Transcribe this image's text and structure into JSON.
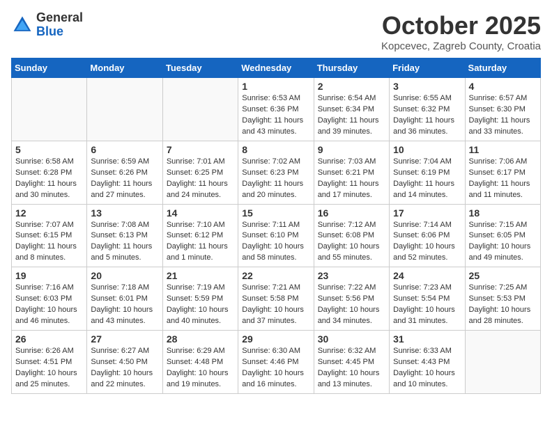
{
  "header": {
    "logo_general": "General",
    "logo_blue": "Blue",
    "month_title": "October 2025",
    "location": "Kopcevec, Zagreb County, Croatia"
  },
  "days_of_week": [
    "Sunday",
    "Monday",
    "Tuesday",
    "Wednesday",
    "Thursday",
    "Friday",
    "Saturday"
  ],
  "weeks": [
    [
      {
        "day": "",
        "info": ""
      },
      {
        "day": "",
        "info": ""
      },
      {
        "day": "",
        "info": ""
      },
      {
        "day": "1",
        "info": "Sunrise: 6:53 AM\nSunset: 6:36 PM\nDaylight: 11 hours\nand 43 minutes."
      },
      {
        "day": "2",
        "info": "Sunrise: 6:54 AM\nSunset: 6:34 PM\nDaylight: 11 hours\nand 39 minutes."
      },
      {
        "day": "3",
        "info": "Sunrise: 6:55 AM\nSunset: 6:32 PM\nDaylight: 11 hours\nand 36 minutes."
      },
      {
        "day": "4",
        "info": "Sunrise: 6:57 AM\nSunset: 6:30 PM\nDaylight: 11 hours\nand 33 minutes."
      }
    ],
    [
      {
        "day": "5",
        "info": "Sunrise: 6:58 AM\nSunset: 6:28 PM\nDaylight: 11 hours\nand 30 minutes."
      },
      {
        "day": "6",
        "info": "Sunrise: 6:59 AM\nSunset: 6:26 PM\nDaylight: 11 hours\nand 27 minutes."
      },
      {
        "day": "7",
        "info": "Sunrise: 7:01 AM\nSunset: 6:25 PM\nDaylight: 11 hours\nand 24 minutes."
      },
      {
        "day": "8",
        "info": "Sunrise: 7:02 AM\nSunset: 6:23 PM\nDaylight: 11 hours\nand 20 minutes."
      },
      {
        "day": "9",
        "info": "Sunrise: 7:03 AM\nSunset: 6:21 PM\nDaylight: 11 hours\nand 17 minutes."
      },
      {
        "day": "10",
        "info": "Sunrise: 7:04 AM\nSunset: 6:19 PM\nDaylight: 11 hours\nand 14 minutes."
      },
      {
        "day": "11",
        "info": "Sunrise: 7:06 AM\nSunset: 6:17 PM\nDaylight: 11 hours\nand 11 minutes."
      }
    ],
    [
      {
        "day": "12",
        "info": "Sunrise: 7:07 AM\nSunset: 6:15 PM\nDaylight: 11 hours\nand 8 minutes."
      },
      {
        "day": "13",
        "info": "Sunrise: 7:08 AM\nSunset: 6:13 PM\nDaylight: 11 hours\nand 5 minutes."
      },
      {
        "day": "14",
        "info": "Sunrise: 7:10 AM\nSunset: 6:12 PM\nDaylight: 11 hours\nand 1 minute."
      },
      {
        "day": "15",
        "info": "Sunrise: 7:11 AM\nSunset: 6:10 PM\nDaylight: 10 hours\nand 58 minutes."
      },
      {
        "day": "16",
        "info": "Sunrise: 7:12 AM\nSunset: 6:08 PM\nDaylight: 10 hours\nand 55 minutes."
      },
      {
        "day": "17",
        "info": "Sunrise: 7:14 AM\nSunset: 6:06 PM\nDaylight: 10 hours\nand 52 minutes."
      },
      {
        "day": "18",
        "info": "Sunrise: 7:15 AM\nSunset: 6:05 PM\nDaylight: 10 hours\nand 49 minutes."
      }
    ],
    [
      {
        "day": "19",
        "info": "Sunrise: 7:16 AM\nSunset: 6:03 PM\nDaylight: 10 hours\nand 46 minutes."
      },
      {
        "day": "20",
        "info": "Sunrise: 7:18 AM\nSunset: 6:01 PM\nDaylight: 10 hours\nand 43 minutes."
      },
      {
        "day": "21",
        "info": "Sunrise: 7:19 AM\nSunset: 5:59 PM\nDaylight: 10 hours\nand 40 minutes."
      },
      {
        "day": "22",
        "info": "Sunrise: 7:21 AM\nSunset: 5:58 PM\nDaylight: 10 hours\nand 37 minutes."
      },
      {
        "day": "23",
        "info": "Sunrise: 7:22 AM\nSunset: 5:56 PM\nDaylight: 10 hours\nand 34 minutes."
      },
      {
        "day": "24",
        "info": "Sunrise: 7:23 AM\nSunset: 5:54 PM\nDaylight: 10 hours\nand 31 minutes."
      },
      {
        "day": "25",
        "info": "Sunrise: 7:25 AM\nSunset: 5:53 PM\nDaylight: 10 hours\nand 28 minutes."
      }
    ],
    [
      {
        "day": "26",
        "info": "Sunrise: 6:26 AM\nSunset: 4:51 PM\nDaylight: 10 hours\nand 25 minutes."
      },
      {
        "day": "27",
        "info": "Sunrise: 6:27 AM\nSunset: 4:50 PM\nDaylight: 10 hours\nand 22 minutes."
      },
      {
        "day": "28",
        "info": "Sunrise: 6:29 AM\nSunset: 4:48 PM\nDaylight: 10 hours\nand 19 minutes."
      },
      {
        "day": "29",
        "info": "Sunrise: 6:30 AM\nSunset: 4:46 PM\nDaylight: 10 hours\nand 16 minutes."
      },
      {
        "day": "30",
        "info": "Sunrise: 6:32 AM\nSunset: 4:45 PM\nDaylight: 10 hours\nand 13 minutes."
      },
      {
        "day": "31",
        "info": "Sunrise: 6:33 AM\nSunset: 4:43 PM\nDaylight: 10 hours\nand 10 minutes."
      },
      {
        "day": "",
        "info": ""
      }
    ]
  ]
}
